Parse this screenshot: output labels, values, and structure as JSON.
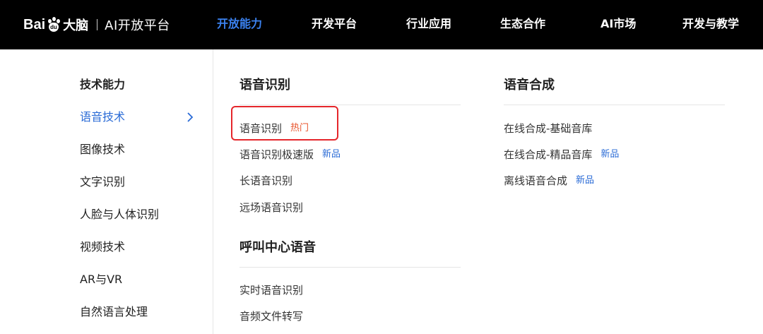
{
  "header": {
    "logo_brand": "Bai",
    "logo_paw_text": "du",
    "logo_suffix": "大脑",
    "logo_sub": "AI开放平台",
    "nav": [
      {
        "label": "开放能力"
      },
      {
        "label": "开发平台"
      },
      {
        "label": "行业应用"
      },
      {
        "label": "生态合作"
      },
      {
        "label": "AI市场"
      },
      {
        "label": "开发与教学"
      }
    ],
    "active_color": "#3b82f0"
  },
  "sidebar": {
    "heading": "技术能力",
    "items": [
      {
        "label": "语音技术"
      },
      {
        "label": "图像技术"
      },
      {
        "label": "文字识别"
      },
      {
        "label": "人脸与人体识别"
      },
      {
        "label": "视频技术"
      },
      {
        "label": "AR与VR"
      },
      {
        "label": "自然语言处理"
      }
    ],
    "active_icon": "chevron-right-icon"
  },
  "sections": {
    "speech_recognition": {
      "title": "语音识别",
      "items": [
        {
          "label": "语音识别",
          "badge": "热门"
        },
        {
          "label": "语音识别极速版",
          "badge": "新品"
        },
        {
          "label": "长语音识别"
        },
        {
          "label": "远场语音识别"
        }
      ]
    },
    "call_center": {
      "title": "呼叫中心语音",
      "items": [
        {
          "label": "实时语音识别"
        },
        {
          "label": "音频文件转写"
        }
      ]
    },
    "speech_synthesis": {
      "title": "语音合成",
      "items": [
        {
          "label": "在线合成-基础音库"
        },
        {
          "label": "在线合成-精品音库",
          "badge": "新品"
        },
        {
          "label": "离线语音合成",
          "badge": "新品"
        }
      ]
    }
  },
  "colors": {
    "hot": "#e8542c",
    "new": "#2a6bd6",
    "highlight_box": "#e5262b"
  }
}
